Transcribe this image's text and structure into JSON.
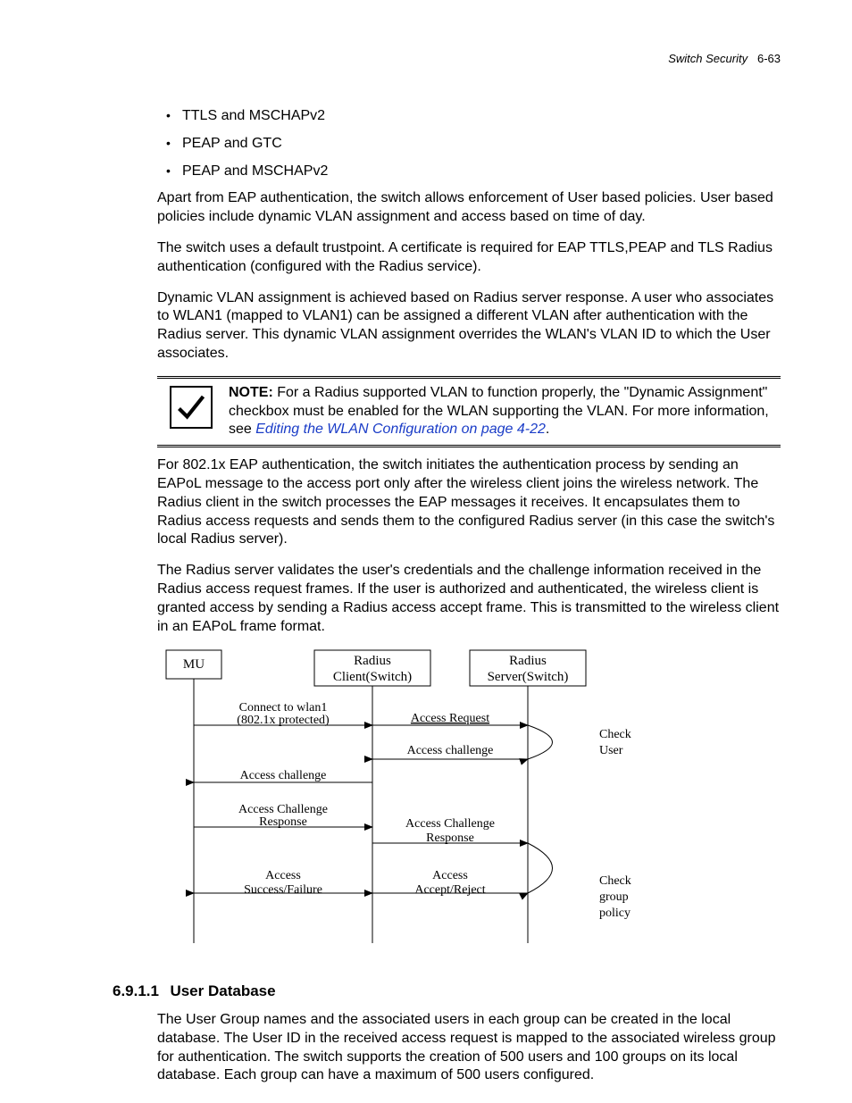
{
  "header": {
    "title": "Switch Security",
    "pagenum": "6-63"
  },
  "bullets": {
    "items": [
      "TTLS and MSCHAPv2",
      "PEAP and GTC",
      "PEAP and MSCHAPv2"
    ]
  },
  "paragraphs": {
    "p1": "Apart from EAP authentication, the switch allows enforcement of User based policies. User based policies include dynamic VLAN assignment and access based on time of day.",
    "p2": "The switch uses a default trustpoint. A certificate is required for EAP TTLS,PEAP and TLS Radius authentication (configured with the Radius service).",
    "p3": "Dynamic VLAN assignment is achieved based on Radius server response. A user who associates to WLAN1 (mapped to VLAN1) can be assigned a different VLAN after authentication with the Radius server. This dynamic VLAN assignment overrides the WLAN's VLAN ID to which the User associates."
  },
  "note": {
    "label": "NOTE:",
    "text": "For a Radius supported VLAN to function properly, the \"Dynamic Assignment\" checkbox must be enabled for the WLAN supporting the VLAN. For more information, see ",
    "link": "Editing the WLAN Configuration on page 4-22",
    "suffix": "."
  },
  "paragraphs2": {
    "p4": "For 802.1x EAP authentication, the switch initiates the authentication process by sending an EAPoL message to the access port only after the wireless client joins the wireless network. The Radius client in the switch processes the EAP messages it receives. It encapsulates them to Radius access requests and sends them to the configured Radius server (in this case the switch's local Radius server).",
    "p5": "The Radius server validates the user's credentials and the challenge information received in the Radius access request frames. If the user is authorized and authenticated, the wireless client is granted access by sending a Radius access accept frame. This is transmitted to the wireless client in an EAPoL frame format."
  },
  "diagram": {
    "cols": {
      "mu": "MU",
      "client": "Radius Client(Switch)",
      "server": "Radius Server(Switch)"
    },
    "labels": {
      "connect1": "Connect to wlan1",
      "connect2": "(802.1x protected)",
      "accessreq": "Access Request",
      "accesschal": "Access challenge",
      "accesschal2": "Access Challenge",
      "response": "Response",
      "accesschalR": "Access Challenge",
      "responseR": "Response",
      "success": "Access",
      "successfail": "Success/Failure",
      "accept": "Access",
      "acceptreject": "Accept/Reject",
      "checkuser": "Check",
      "checkuser2": "User",
      "checkgroup": "Check",
      "checkgroup2": "group",
      "checkgroup3": "policy"
    }
  },
  "section": {
    "num": "6.9.1.1",
    "title": "User Database",
    "body": "The User Group names and the associated users in each group can be created in the local database. The User ID in the received access request is mapped to the associated wireless group for authentication. The switch supports the creation of 500 users and 100 groups on its local database. Each group can have a maximum of 500 users configured."
  }
}
